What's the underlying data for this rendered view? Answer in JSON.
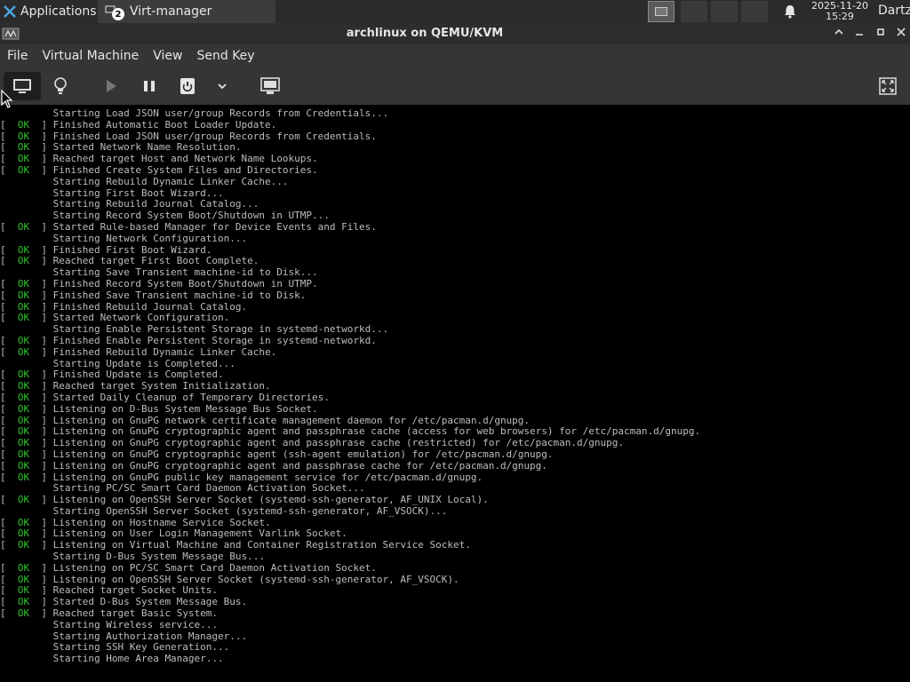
{
  "panel": {
    "applications_label": "Applications",
    "task_label": "Virt-manager",
    "task_badge": "2",
    "clock_date": "2025-11-20",
    "clock_time": "15:29",
    "user": "Dartz"
  },
  "window": {
    "title": "archlinux on QEMU/KVM"
  },
  "menu": {
    "file": "File",
    "virtual_machine": "Virtual Machine",
    "view": "View",
    "send_key": "Send Key"
  },
  "toolbar": {
    "icons": [
      "monitor-icon",
      "lightbulb-icon",
      "play-icon",
      "pause-icon",
      "power-icon",
      "chevron-down-icon",
      "snapshot-icon",
      "fullscreen-icon"
    ]
  },
  "console": {
    "ok_label": " OK ",
    "lines": [
      {
        "status": false,
        "text": "Starting Load JSON user/group Records from Credentials..."
      },
      {
        "status": true,
        "text": "Finished Automatic Boot Loader Update."
      },
      {
        "status": true,
        "text": "Finished Load JSON user/group Records from Credentials."
      },
      {
        "status": true,
        "text": "Started Network Name Resolution."
      },
      {
        "status": true,
        "text": "Reached target Host and Network Name Lookups."
      },
      {
        "status": true,
        "text": "Finished Create System Files and Directories."
      },
      {
        "status": false,
        "text": "Starting Rebuild Dynamic Linker Cache..."
      },
      {
        "status": false,
        "text": "Starting First Boot Wizard..."
      },
      {
        "status": false,
        "text": "Starting Rebuild Journal Catalog..."
      },
      {
        "status": false,
        "text": "Starting Record System Boot/Shutdown in UTMP..."
      },
      {
        "status": true,
        "text": "Started Rule-based Manager for Device Events and Files."
      },
      {
        "status": false,
        "text": "Starting Network Configuration..."
      },
      {
        "status": true,
        "text": "Finished First Boot Wizard."
      },
      {
        "status": true,
        "text": "Reached target First Boot Complete."
      },
      {
        "status": false,
        "text": "Starting Save Transient machine-id to Disk..."
      },
      {
        "status": true,
        "text": "Finished Record System Boot/Shutdown in UTMP."
      },
      {
        "status": true,
        "text": "Finished Save Transient machine-id to Disk."
      },
      {
        "status": true,
        "text": "Finished Rebuild Journal Catalog."
      },
      {
        "status": true,
        "text": "Started Network Configuration."
      },
      {
        "status": false,
        "text": "Starting Enable Persistent Storage in systemd-networkd..."
      },
      {
        "status": true,
        "text": "Finished Enable Persistent Storage in systemd-networkd."
      },
      {
        "status": true,
        "text": "Finished Rebuild Dynamic Linker Cache."
      },
      {
        "status": false,
        "text": "Starting Update is Completed..."
      },
      {
        "status": true,
        "text": "Finished Update is Completed."
      },
      {
        "status": true,
        "text": "Reached target System Initialization."
      },
      {
        "status": true,
        "text": "Started Daily Cleanup of Temporary Directories."
      },
      {
        "status": true,
        "text": "Listening on D-Bus System Message Bus Socket."
      },
      {
        "status": true,
        "text": "Listening on GnuPG network certificate management daemon for /etc/pacman.d/gnupg."
      },
      {
        "status": true,
        "text": "Listening on GnuPG cryptographic agent and passphrase cache (access for web browsers) for /etc/pacman.d/gnupg."
      },
      {
        "status": true,
        "text": "Listening on GnuPG cryptographic agent and passphrase cache (restricted) for /etc/pacman.d/gnupg."
      },
      {
        "status": true,
        "text": "Listening on GnuPG cryptographic agent (ssh-agent emulation) for /etc/pacman.d/gnupg."
      },
      {
        "status": true,
        "text": "Listening on GnuPG cryptographic agent and passphrase cache for /etc/pacman.d/gnupg."
      },
      {
        "status": true,
        "text": "Listening on GnuPG public key management service for /etc/pacman.d/gnupg."
      },
      {
        "status": false,
        "text": "Starting PC/SC Smart Card Daemon Activation Socket..."
      },
      {
        "status": true,
        "text": "Listening on OpenSSH Server Socket (systemd-ssh-generator, AF_UNIX Local)."
      },
      {
        "status": false,
        "text": "Starting OpenSSH Server Socket (systemd-ssh-generator, AF_VSOCK)..."
      },
      {
        "status": true,
        "text": "Listening on Hostname Service Socket."
      },
      {
        "status": true,
        "text": "Listening on User Login Management Varlink Socket."
      },
      {
        "status": true,
        "text": "Listening on Virtual Machine and Container Registration Service Socket."
      },
      {
        "status": false,
        "text": "Starting D-Bus System Message Bus..."
      },
      {
        "status": true,
        "text": "Listening on PC/SC Smart Card Daemon Activation Socket."
      },
      {
        "status": true,
        "text": "Listening on OpenSSH Server Socket (systemd-ssh-generator, AF_VSOCK)."
      },
      {
        "status": true,
        "text": "Reached target Socket Units."
      },
      {
        "status": true,
        "text": "Started D-Bus System Message Bus."
      },
      {
        "status": true,
        "text": "Reached target Basic System."
      },
      {
        "status": false,
        "text": "Starting Wireless service..."
      },
      {
        "status": false,
        "text": "Starting Authorization Manager..."
      },
      {
        "status": false,
        "text": "Starting SSH Key Generation..."
      },
      {
        "status": false,
        "text": "Starting Home Area Manager..."
      }
    ]
  }
}
